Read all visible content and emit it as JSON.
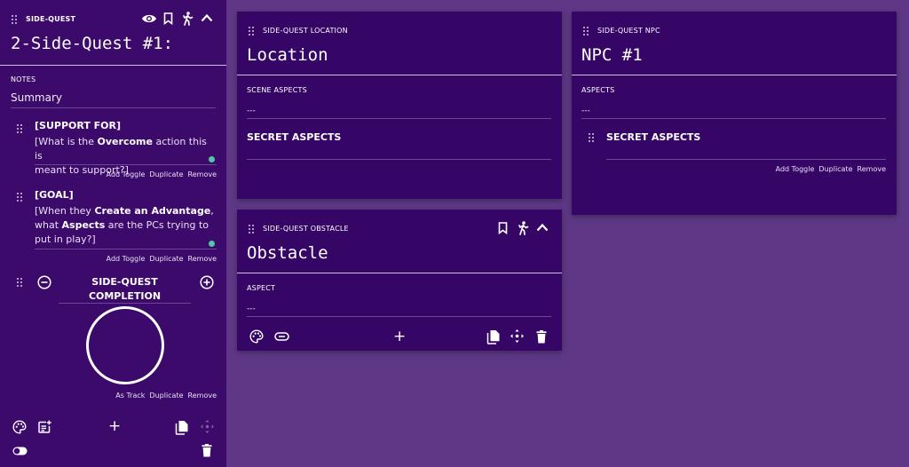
{
  "sidebar": {
    "kind": "SIDE-QUEST",
    "title": "2-Side-Quest #1:",
    "notes_label": "NOTES",
    "notes_value": "Summary",
    "support": {
      "heading": "[SUPPORT FOR]",
      "text_a": "[What is the ",
      "text_b": "Overcome",
      "text_c": " action this is",
      "text_d": "meant to support?]",
      "actions": [
        "Add Toggle",
        "Duplicate",
        "Remove"
      ]
    },
    "goal": {
      "heading": "[GOAL]",
      "line1_a": "[When they ",
      "line1_b": "Create an Advantage",
      "line1_c": ",",
      "line2_a": "what ",
      "line2_b": "Aspects",
      "line2_c": " are the PCs trying to",
      "line3": "put in play?]",
      "actions": [
        "Add Toggle",
        "Duplicate",
        "Remove"
      ]
    },
    "completion": {
      "label_line1": "SIDE-QUEST",
      "label_line2": "COMPLETION",
      "actions": [
        "As Track",
        "Duplicate",
        "Remove"
      ]
    },
    "footer_add": "+"
  },
  "location_card": {
    "kind": "SIDE-QUEST LOCATION",
    "title": "Location",
    "field_label": "SCENE ASPECTS",
    "field_value": "---",
    "secret": "SECRET ASPECTS"
  },
  "npc_card": {
    "kind": "SIDE-QUEST NPC",
    "title": "NPC #1",
    "field_label": "ASPECTS",
    "field_value": "---",
    "secret": "SECRET ASPECTS",
    "actions": [
      "Add Toggle",
      "Duplicate",
      "Remove"
    ]
  },
  "obstacle_card": {
    "kind": "SIDE-QUEST OBSTACLE",
    "title": "Obstacle",
    "field_label": "ASPECT",
    "field_value": "---",
    "footer_add": "+"
  },
  "colors": {
    "background": "#5e3886",
    "sidebar": "#3b0a6a",
    "card": "#350666",
    "dot_green": "#4fc7a0"
  }
}
